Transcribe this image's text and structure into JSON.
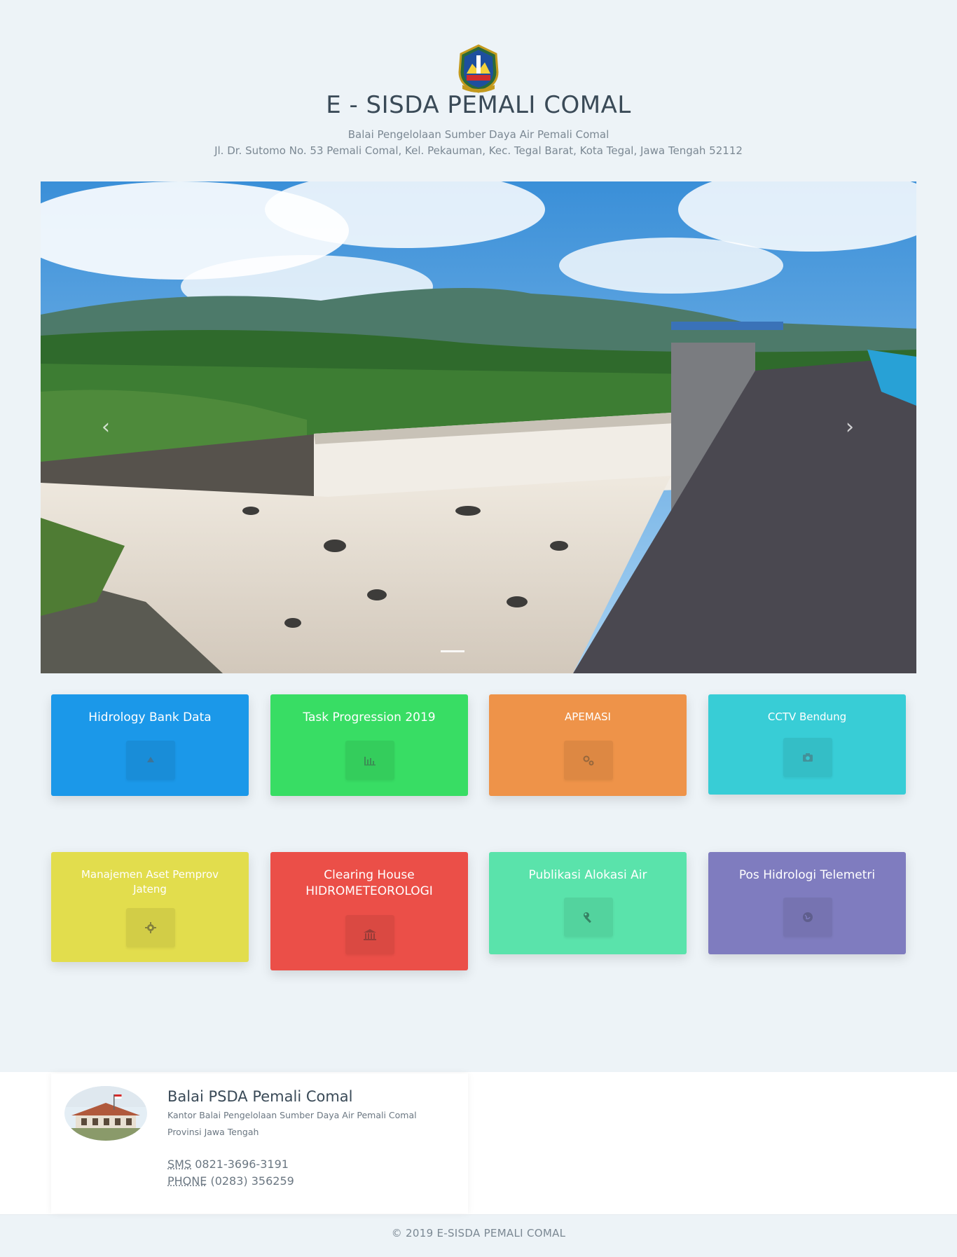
{
  "header": {
    "title": "E - SISDA PEMALI COMAL",
    "subtitle": "Balai Pengelolaan Sumber Daya Air Pemali Comal",
    "address": "Jl. Dr. Sutomo No. 53 Pemali Comal, Kel. Pekauman, Kec. Tegal Barat, Kota Tegal, Jawa Tengah 52112"
  },
  "carousel": {
    "prev_icon": "chevron-left-icon",
    "next_icon": "chevron-right-icon",
    "prev_glyph": "‹",
    "next_glyph": "›"
  },
  "tiles": [
    {
      "label": "Hidrology Bank Data",
      "icon": "upload-icon",
      "color": "#1b98e9"
    },
    {
      "label": "Task Progression 2019",
      "icon": "bar-chart-icon",
      "color": "#38dd64"
    },
    {
      "label": "APEMASI",
      "icon": "gears-icon",
      "color": "#ee9349"
    },
    {
      "label": "CCTV Bendung",
      "icon": "camera-icon",
      "color": "#38cdd6"
    },
    {
      "label": "Manajemen Aset Pemprov Jateng",
      "icon": "gear-icon",
      "color": "#e2dd4d"
    },
    {
      "label": "Clearing House HIDROMETEOROLOGI",
      "icon": "bank-icon",
      "color": "#eb4f48"
    },
    {
      "label": "Publikasi Alokasi Air",
      "icon": "wrench-icon",
      "color": "#5ae3ab"
    },
    {
      "label": "Pos Hidrologi Telemetri",
      "icon": "globe-icon",
      "color": "#7f7cbf"
    }
  ],
  "contact": {
    "name": "Balai PSDA Pemali Comal",
    "desc1": "Kantor Balai Pengelolaan Sumber Daya Air Pemali Comal",
    "desc2": "Provinsi Jawa Tengah",
    "sms_label": "SMS",
    "sms_value": "0821-3696-3191",
    "phone_label": "PHONE",
    "phone_value": "(0283) 356259"
  },
  "footer": {
    "copyright": "© 2019 E-SISDA PEMALI COMAL"
  }
}
